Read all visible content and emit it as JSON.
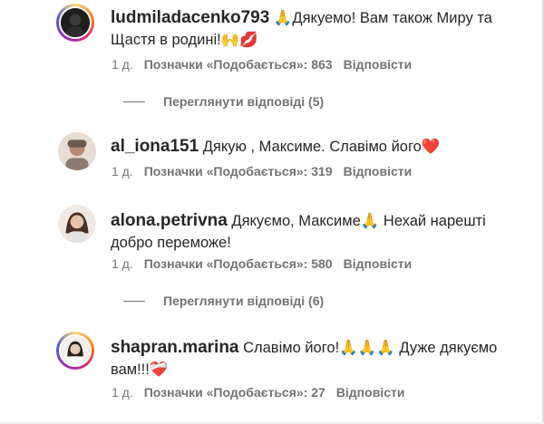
{
  "comments": [
    {
      "username": "ludmiladacenko793",
      "text_a": " 🙏Дякуемо! Вам також Миру та",
      "text_b": "Щастя в родині!🙌💋",
      "time": "1 д.",
      "likes": "Позначки «Подобається»: 863",
      "reply": "Відповісти",
      "replies": "Переглянути відповіді (5)"
    },
    {
      "username": "al_iona151",
      "text_a": " Дякую , Максиме. Славімо його❤️",
      "time": "1 д.",
      "likes": "Позначки «Подобається»: 319",
      "reply": "Відповісти"
    },
    {
      "username": "alona.petrivna",
      "text_a": " Дякуємо, Максиме🙏 Нехай нарешті",
      "text_b": "добро переможе!",
      "time": "1 д.",
      "likes": "Позначки «Подобається»: 580",
      "reply": "Відповісти",
      "replies": "Переглянути відповіді (6)"
    },
    {
      "username": "shapran.marina",
      "text_a": " Славімо його!🙏🙏🙏 Дуже дякуємо",
      "text_b": "вам!!!❤️‍🩹",
      "time": "1 д.",
      "likes": "Позначки «Подобається»: 27",
      "reply": "Відповісти"
    }
  ],
  "colors": {
    "text": "#262626",
    "secondary": "#737373",
    "story_ring": "#d62976"
  }
}
